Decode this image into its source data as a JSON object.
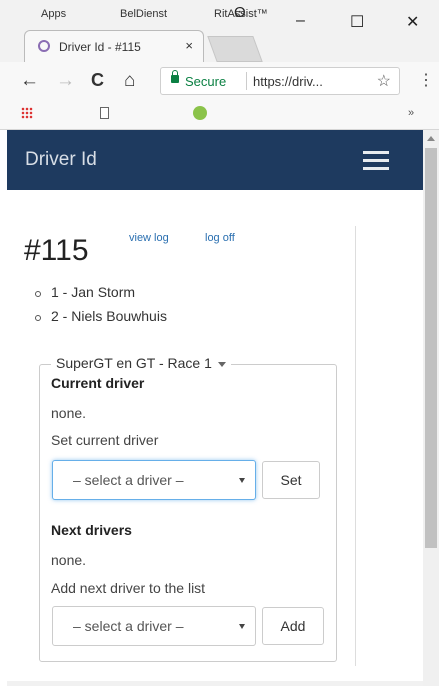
{
  "browser": {
    "tab_title": "Driver Id - #115",
    "tab_close": "×",
    "window_controls": {
      "minimize": "–",
      "maximize": "☐",
      "close": "✕"
    },
    "account_icon": "person-circle-icon",
    "nav": {
      "back": "←",
      "forward": "→",
      "reload": "C",
      "home": "⌂"
    },
    "secure_label": "Secure",
    "url": "https://driv...",
    "star": "☆",
    "menu": "⋮",
    "bookmarks": {
      "apps": "Apps",
      "beldienst": "BelDienst",
      "ritassist": "RitAssist™",
      "more": "»"
    }
  },
  "navbar": {
    "brand": "Driver Id",
    "menu_icon": "hamburger-icon"
  },
  "page": {
    "id_title": "#115",
    "view_log": "view log",
    "log_off": "log off",
    "drivers": [
      "1 - Jan Storm",
      "2 - Niels Bouwhuis"
    ],
    "race": {
      "legend": "SuperGT en GT - Race 1",
      "current_driver_heading": "Current driver",
      "current_driver_value": "none.",
      "set_current_label": "Set current driver",
      "select_placeholder": "– select a driver –",
      "set_button": "Set",
      "next_drivers_heading": "Next drivers",
      "next_drivers_value": "none.",
      "add_next_label": "Add next driver to the list",
      "select_placeholder_2": "– select a driver –",
      "add_button": "Add"
    }
  },
  "colors": {
    "navbar_bg": "#1e3a5f",
    "link": "#2a6fb0",
    "secure": "#0b8043",
    "focus": "#66afe9"
  }
}
